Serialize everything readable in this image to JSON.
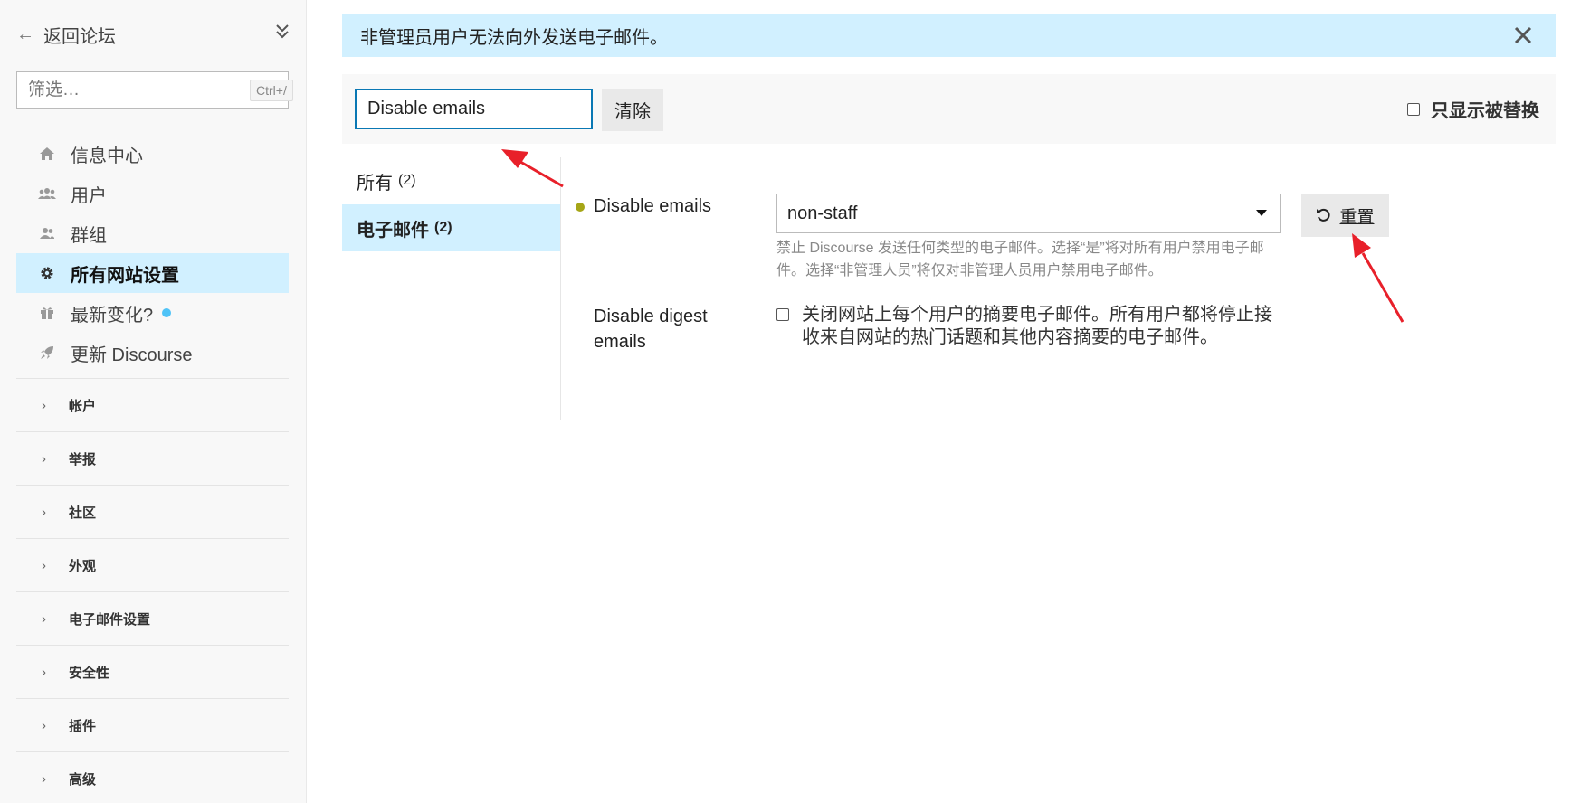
{
  "sidebar": {
    "back_label": "返回论坛",
    "filter_placeholder": "筛选…",
    "filter_shortcut": "Ctrl+/",
    "nav": [
      {
        "label": "信息中心",
        "icon": "home-icon"
      },
      {
        "label": "用户",
        "icon": "users-icon"
      },
      {
        "label": "群组",
        "icon": "group-icon"
      },
      {
        "label": "所有网站设置",
        "icon": "gear-icon",
        "active": true
      },
      {
        "label": "最新变化?",
        "icon": "gift-icon"
      },
      {
        "label": "更新 Discourse",
        "icon": "rocket-icon"
      }
    ],
    "sections": [
      "帐户",
      "举报",
      "社区",
      "外观",
      "电子邮件设置",
      "安全性",
      "插件",
      "高级"
    ]
  },
  "banner": {
    "text": "非管理员用户无法向外发送电子邮件。"
  },
  "search": {
    "value": "Disable emails",
    "clear_label": "清除",
    "only_overridden_label": "只显示被替换"
  },
  "categories": [
    {
      "label": "所有",
      "count": "(2)"
    },
    {
      "label": "电子邮件",
      "count": "(2)",
      "active": true
    }
  ],
  "settings": [
    {
      "name": "Disable emails",
      "value": "non-staff",
      "description": "禁止 Discourse 发送任何类型的电子邮件。选择“是”将对所有用户禁用电子邮件。选择“非管理人员”将仅对非管理人员用户禁用电子邮件。",
      "reset_label": "重置"
    },
    {
      "name": "Disable digest emails",
      "description": "关闭网站上每个用户的摘要电子邮件。所有用户都将停止接收来自网站的热门话题和其他内容摘要的电子邮件。"
    }
  ],
  "colors": {
    "accent_blue": "#0a78b4",
    "highlight": "#d1f0ff",
    "overridden_dot": "#a6a617",
    "annotation_arrow": "#e8202a"
  }
}
